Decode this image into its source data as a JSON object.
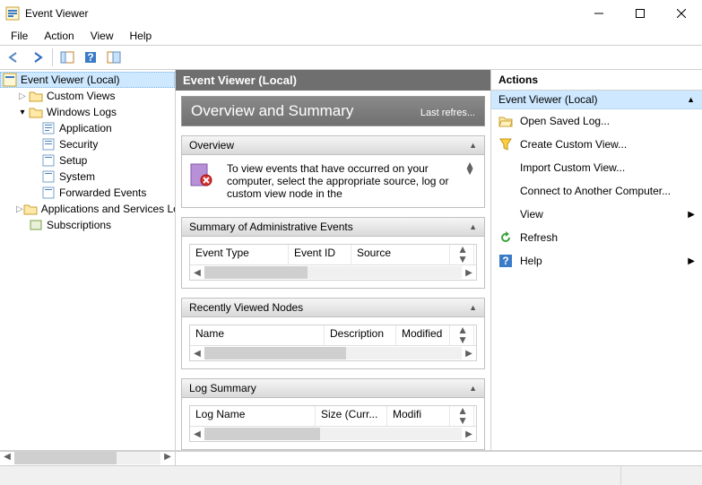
{
  "window": {
    "title": "Event Viewer"
  },
  "menu": {
    "file": "File",
    "action": "Action",
    "view": "View",
    "help": "Help"
  },
  "tree": {
    "root": "Event Viewer (Local)",
    "custom_views": "Custom Views",
    "windows_logs": "Windows Logs",
    "logs": {
      "application": "Application",
      "security": "Security",
      "setup": "Setup",
      "system": "System",
      "forwarded": "Forwarded Events"
    },
    "app_services": "Applications and Services Lo",
    "subscriptions": "Subscriptions"
  },
  "center": {
    "header": "Event Viewer (Local)",
    "banner_title": "Overview and Summary",
    "banner_sub": "Last refres...",
    "overview": {
      "title": "Overview",
      "text": "To view events that have occurred on your computer, select the appropriate source, log or custom view node in the"
    },
    "summary": {
      "title": "Summary of Administrative Events",
      "cols": {
        "event_type": "Event Type",
        "event_id": "Event ID",
        "source": "Source"
      }
    },
    "recent": {
      "title": "Recently Viewed Nodes",
      "cols": {
        "name": "Name",
        "description": "Description",
        "modified": "Modified"
      }
    },
    "logsum": {
      "title": "Log Summary",
      "cols": {
        "log_name": "Log Name",
        "size": "Size (Curr...",
        "modified": "Modifi"
      }
    }
  },
  "actions": {
    "header": "Actions",
    "context": "Event Viewer (Local)",
    "items": {
      "open_saved": "Open Saved Log...",
      "create_custom": "Create Custom View...",
      "import_custom": "Import Custom View...",
      "connect": "Connect to Another Computer...",
      "view": "View",
      "refresh": "Refresh",
      "help": "Help"
    }
  }
}
